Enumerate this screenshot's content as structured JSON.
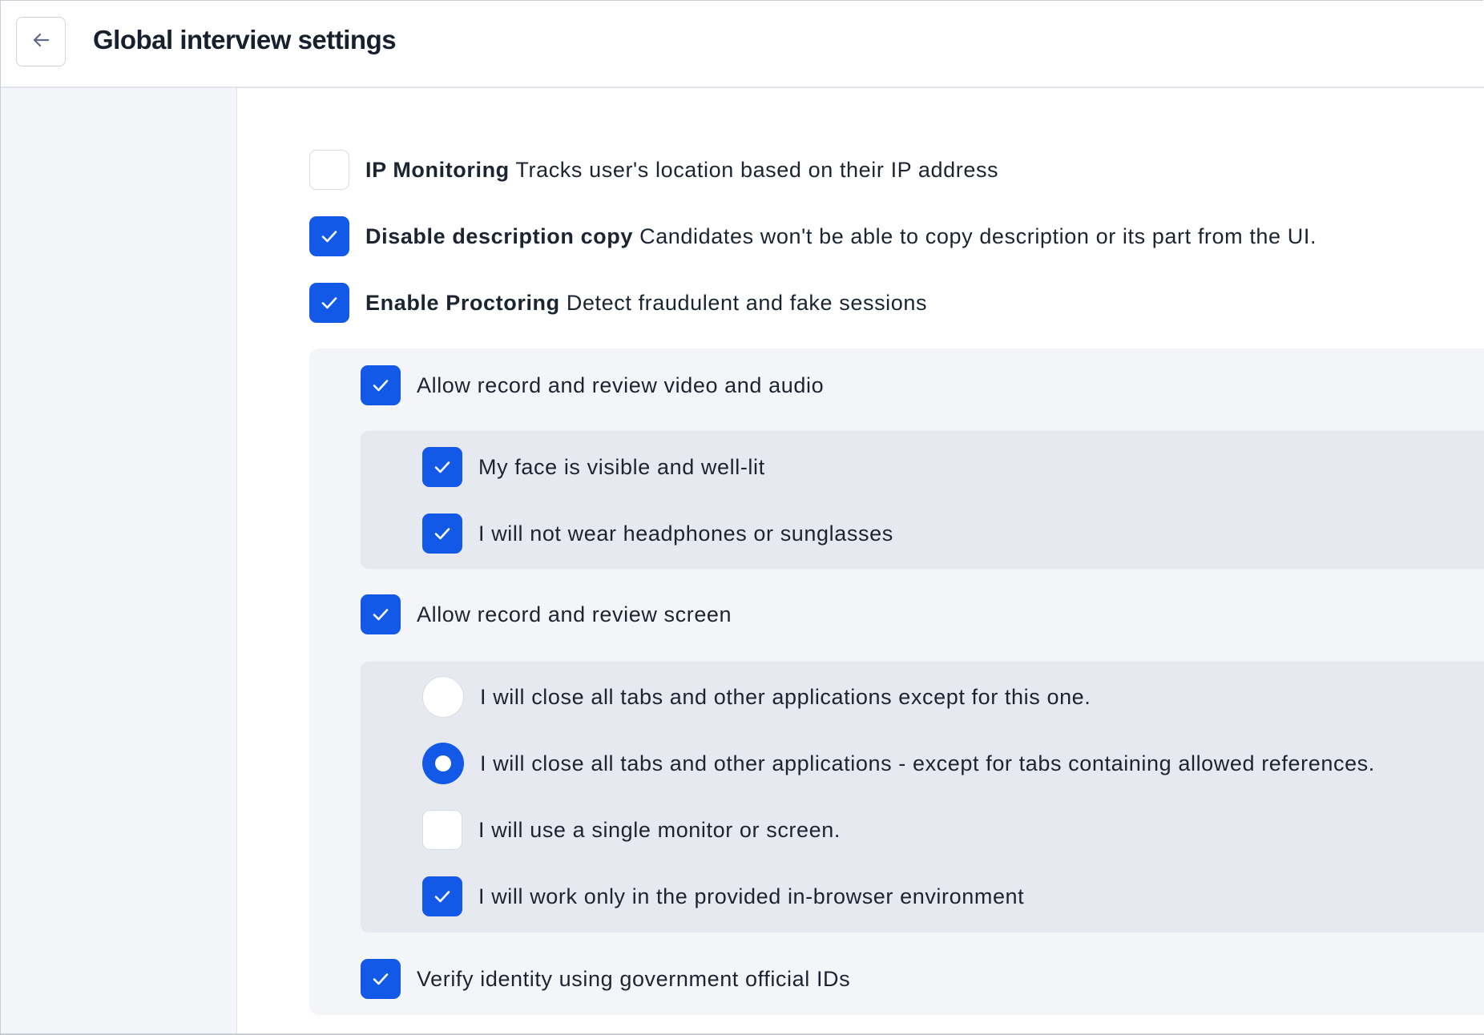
{
  "header": {
    "title": "Global interview settings",
    "back_icon": "arrow-left-icon"
  },
  "colors": {
    "accent": "#1259e8",
    "sidebar_bg": "#f4f5f8",
    "panel_bg": "#f4f5f8",
    "subpanel_bg": "#e7e9f0"
  },
  "settings": {
    "ip_monitoring": {
      "title": "IP Monitoring",
      "description": "Tracks user's location based on their IP address",
      "checked": false
    },
    "disable_copy": {
      "title": "Disable description copy",
      "description": "Candidates won't be able to copy description or its part from the UI.",
      "checked": true
    },
    "proctoring": {
      "title": "Enable Proctoring",
      "description": "Detect fraudulent and fake sessions",
      "checked": true
    }
  },
  "proctoring": {
    "video_audio": {
      "label": "Allow record and review video and audio",
      "checked": true
    },
    "video_rules": [
      {
        "label": "My face is visible and well-lit",
        "checked": true
      },
      {
        "label": "I will not wear headphones or sunglasses",
        "checked": true
      }
    ],
    "screen": {
      "label": "Allow record and review screen",
      "checked": true
    },
    "screen_rules": [
      {
        "label": "I will close all tabs and other applications except for this one.",
        "control": "radio",
        "selected": false
      },
      {
        "label": "I will close all tabs and other applications - except for tabs containing allowed references.",
        "control": "radio",
        "selected": true
      },
      {
        "label": "I will use a single monitor or screen.",
        "control": "checkbox",
        "checked": false
      },
      {
        "label": "I will work only in the provided in-browser environment",
        "control": "checkbox",
        "checked": true
      }
    ],
    "verify_identity": {
      "label": "Verify identity using government official IDs",
      "checked": true
    }
  }
}
